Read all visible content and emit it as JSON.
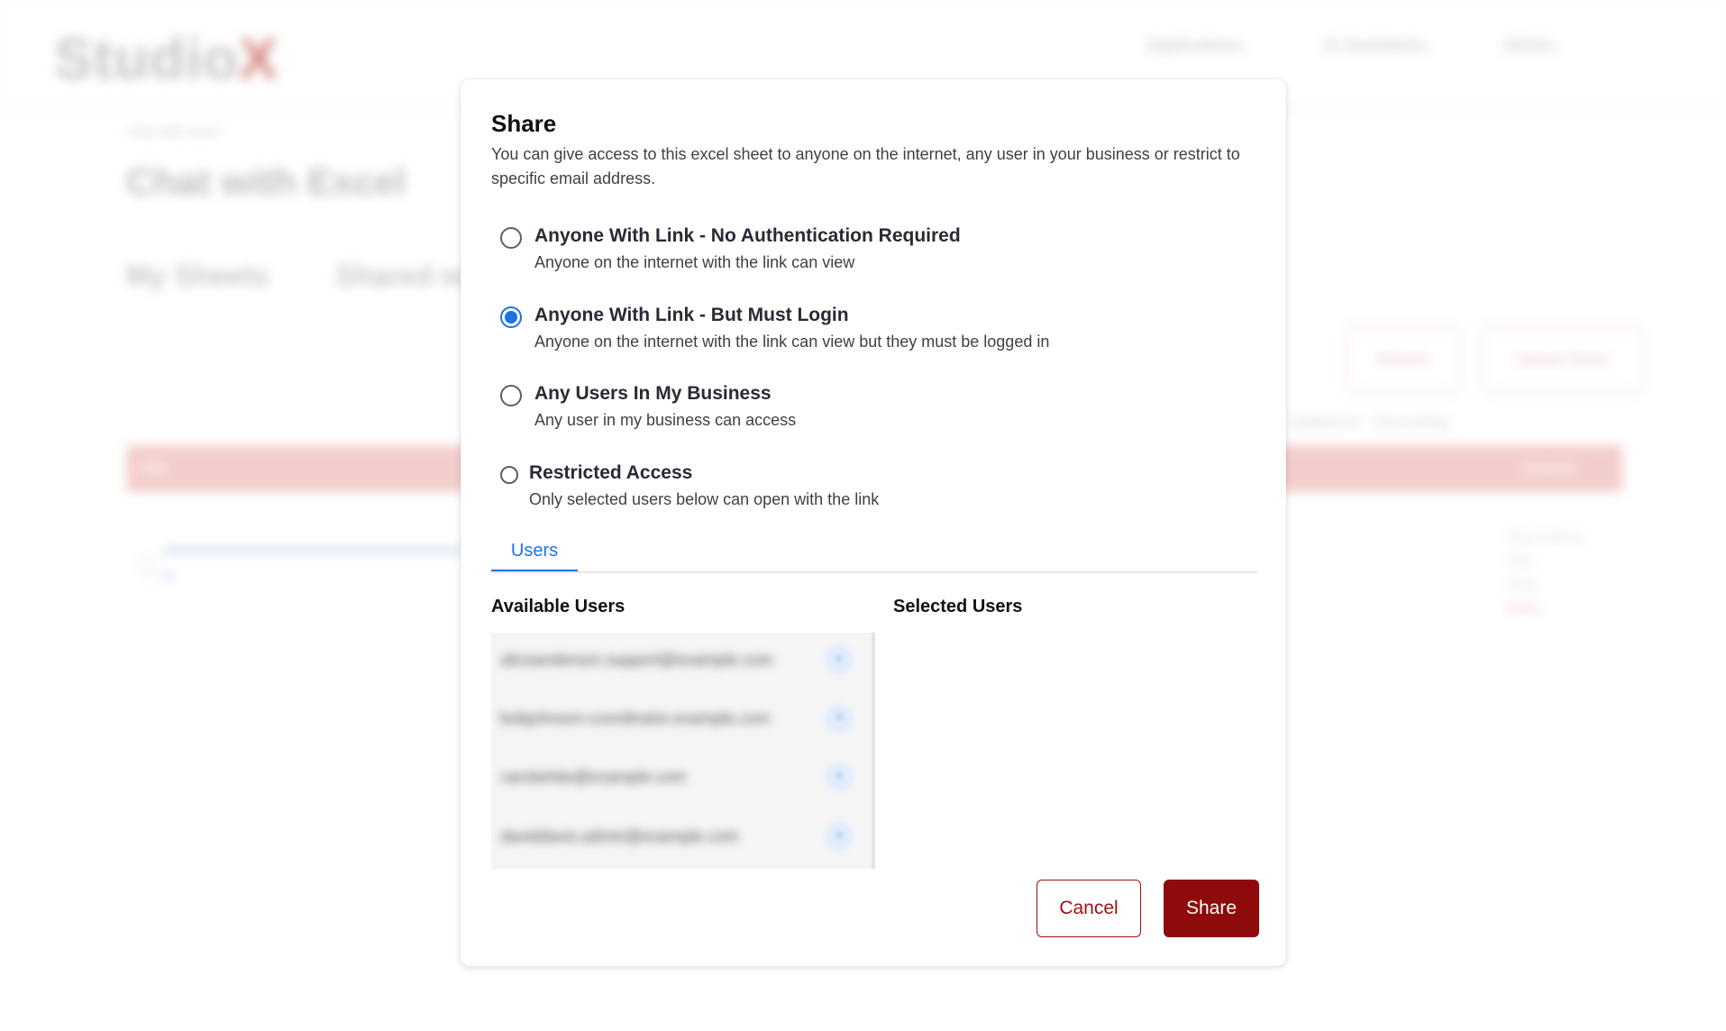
{
  "background": {
    "logo": {
      "text": "Studio",
      "x": "X"
    },
    "nav": [
      "Applications",
      "AI Assistants",
      "Admin"
    ],
    "breadcrumb": "Chat with Excel",
    "title": "Chat with Excel",
    "tabs": [
      "My Sheets",
      "Shared wi"
    ],
    "buttons": [
      "Refresh",
      "Upload Sheet"
    ],
    "sort": "Updated At  ·  Descending",
    "table_headers": [
      "File",
      "Actions"
    ],
    "row_actions": [
      "View Columns",
      "Chat",
      "Share",
      "Delete"
    ]
  },
  "modal": {
    "title": "Share",
    "description": "You can give access to this excel sheet to anyone on the internet, any user in your business or restrict to specific email address.",
    "options": [
      {
        "label": "Anyone With Link - No Authentication Required",
        "desc": "Anyone on the internet with the link can view",
        "checked": false
      },
      {
        "label": "Anyone With Link - But Must Login",
        "desc": "Anyone on the internet with the link can view but they must be logged in",
        "checked": true
      },
      {
        "label": "Any Users In My Business",
        "desc": "Any user in my business can access",
        "checked": false
      },
      {
        "label": "Restricted Access",
        "desc": "Only selected users below can open with the link",
        "checked": false
      }
    ],
    "tab": "Users",
    "available_users_heading": "Available Users",
    "selected_users_heading": "Selected Users",
    "available_users": [
      {
        "email": "aliceanderson.support@example.com",
        "action": "+"
      },
      {
        "email": "bobjohnson.coordinator.example.com",
        "action": "+"
      },
      {
        "email": "carolwhite@example.com",
        "action": "+"
      },
      {
        "email": "daviddavis.admin@example.com",
        "action": "+"
      }
    ],
    "cancel_label": "Cancel",
    "share_label": "Share"
  },
  "colors": {
    "accent": "#1a73e8",
    "brand": "#8f0a0a"
  }
}
